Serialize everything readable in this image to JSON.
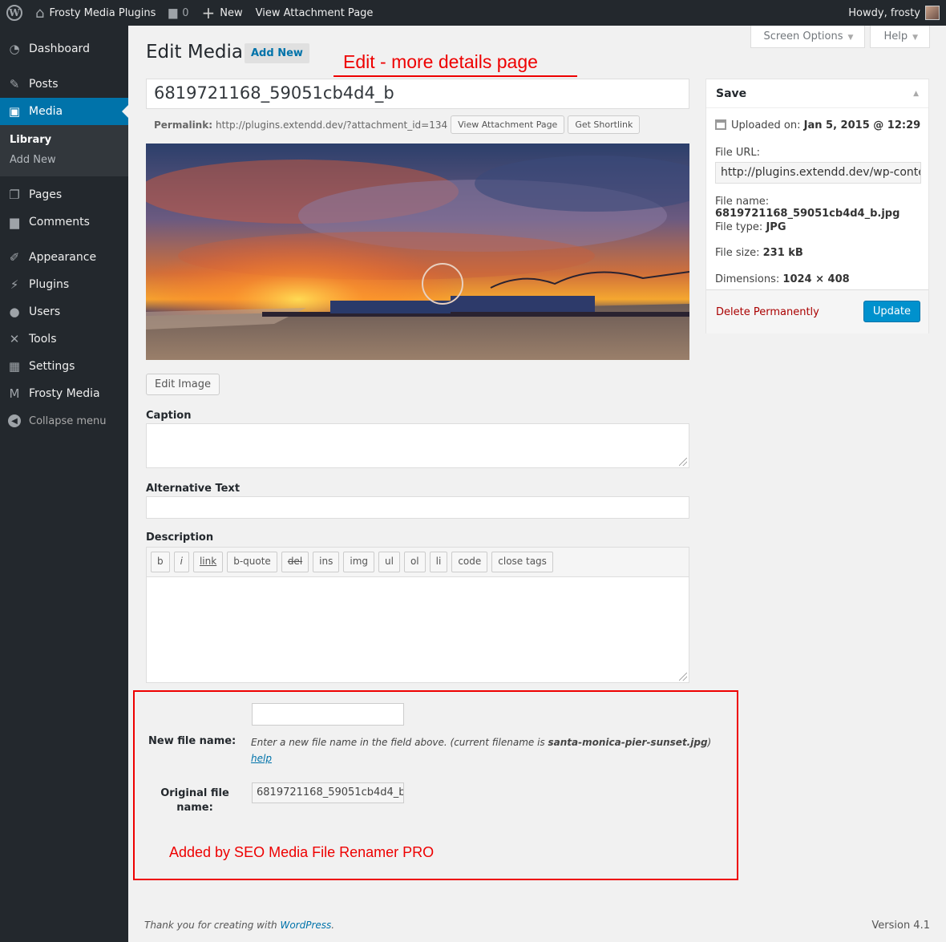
{
  "admin_bar": {
    "site_name": "Frosty Media Plugins",
    "comments_count": "0",
    "new_label": "New",
    "view_attachment": "View Attachment Page",
    "howdy": "Howdy, frosty"
  },
  "sidebar": {
    "items": [
      {
        "label": "Dashboard",
        "icon": "dashboard-icon"
      },
      {
        "label": "Posts",
        "icon": "pin-icon"
      },
      {
        "label": "Media",
        "icon": "media-icon"
      },
      {
        "label": "Pages",
        "icon": "pages-icon"
      },
      {
        "label": "Comments",
        "icon": "comments-icon"
      },
      {
        "label": "Appearance",
        "icon": "appearance-icon"
      },
      {
        "label": "Plugins",
        "icon": "plugins-icon"
      },
      {
        "label": "Users",
        "icon": "users-icon"
      },
      {
        "label": "Tools",
        "icon": "tools-icon"
      },
      {
        "label": "Settings",
        "icon": "settings-icon"
      },
      {
        "label": "Frosty Media",
        "icon": "frosty-media-icon"
      }
    ],
    "media_submenu": [
      "Library",
      "Add New"
    ],
    "collapse": "Collapse menu"
  },
  "screen_tabs": {
    "screen_options": "Screen Options",
    "help": "Help"
  },
  "page": {
    "title": "Edit Media",
    "add_new": "Add New",
    "annotation_top": "Edit - more details page",
    "media_title": "6819721168_59051cb4d4_b",
    "permalink_label": "Permalink:",
    "permalink_url": "http://plugins.extendd.dev/?attachment_id=134",
    "view_attachment_btn": "View Attachment Page",
    "shortlink_btn": "Get Shortlink",
    "edit_image_btn": "Edit Image",
    "caption_label": "Caption",
    "alt_label": "Alternative Text",
    "description_label": "Description",
    "quicktags": [
      "b",
      "i",
      "link",
      "b-quote",
      "del",
      "ins",
      "img",
      "ul",
      "ol",
      "li",
      "code",
      "close tags"
    ]
  },
  "renamer": {
    "new_file_label": "New file name:",
    "desc_prefix": "Enter a new file name in the field above. (current filename is ",
    "desc_filename": "santa-monica-pier-sunset.jpg",
    "desc_suffix": ")",
    "help": "help",
    "original_label": "Original file name:",
    "original_value": "6819721168_59051cb4d4_b",
    "annotation": "Added by SEO Media File Renamer PRO"
  },
  "save_box": {
    "title": "Save",
    "uploaded_label": "Uploaded on:",
    "uploaded_value": "Jan 5, 2015 @ 12:29",
    "file_url_label": "File URL:",
    "file_url_value": "http://plugins.extendd.dev/wp-content/uploads",
    "file_name_label": "File name:",
    "file_name_value": "6819721168_59051cb4d4_b.jpg",
    "file_type_label": "File type:",
    "file_type_value": "JPG",
    "file_size_label": "File size:",
    "file_size_value": "231 kB",
    "dimensions_label": "Dimensions:",
    "dimensions_value": "1024 × 408",
    "delete": "Delete Permanently",
    "update": "Update"
  },
  "footer": {
    "thanks_prefix": "Thank you for creating with ",
    "wordpress": "WordPress",
    "thanks_suffix": ".",
    "version": "Version 4.1"
  },
  "colors": {
    "accent": "#0073aa",
    "annotation": "#e00000",
    "adminbar": "#23282d"
  }
}
